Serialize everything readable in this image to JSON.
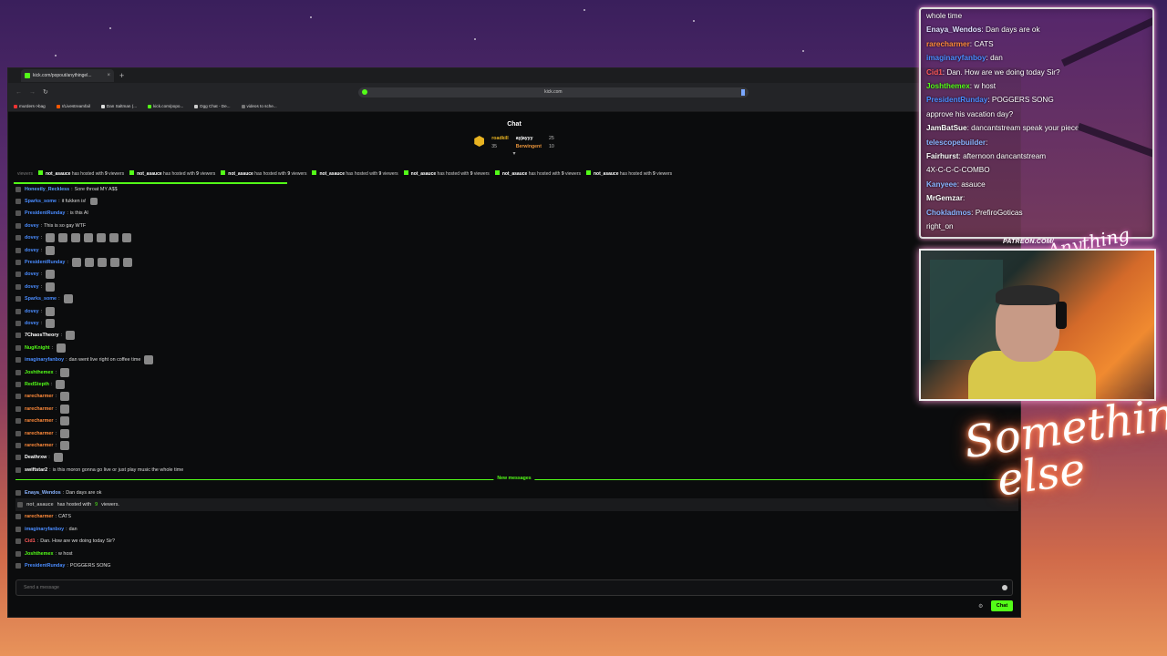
{
  "browser": {
    "tab_title": "kick.com/popout/anythingel...",
    "new_tab_symbol": "+",
    "tab_close_symbol": "×",
    "url": "kick.com",
    "bookmarks": [
      "murders->bag",
      "r/Livestreamfail",
      "Dan Saltman (...",
      "kick.com/popo...",
      "Dgg Chat - De...",
      "videos to sche..."
    ]
  },
  "chat": {
    "title": "Chat",
    "leaderboard": [
      {
        "name": "roadkill",
        "count": "35"
      },
      {
        "name": "ayjayyy",
        "count": "25"
      },
      {
        "name": "Berwingent",
        "count": "10"
      }
    ],
    "hosted_line": {
      "lead": "viewers",
      "user": "not_asauce",
      "text": "has hosted with",
      "count": "9",
      "suffix": "viewers",
      "repeat": 7
    },
    "messages": [
      {
        "user": "Honestly_Reckless",
        "color": "#5aa0ff",
        "text": "Sore throat MY A$$"
      },
      {
        "user": "Sparks_some",
        "color": "#4a8cff",
        "text": "it fukken is!",
        "emote": true
      },
      {
        "user": "PresidentRunday",
        "color": "#4a8cff",
        "text": "is this AI"
      },
      {
        "user": "dovey",
        "color": "#4a8cff",
        "text": "This is so gay WTF"
      },
      {
        "user": "dovey",
        "color": "#4a8cff",
        "text": "",
        "emotes": 7
      },
      {
        "user": "dovey",
        "color": "#4a8cff",
        "text": "",
        "emotes": 1
      },
      {
        "user": "PresidentRunday",
        "color": "#4a8cff",
        "text": "",
        "emotes": 5
      },
      {
        "user": "dovey",
        "color": "#4a8cff",
        "text": "",
        "emotes": 1
      },
      {
        "user": "dovey",
        "color": "#4a8cff",
        "text": "",
        "emotes": 1
      },
      {
        "user": "Sparks_some",
        "color": "#4a8cff",
        "text": "",
        "emotes": 1
      },
      {
        "user": "dovey",
        "color": "#4a8cff",
        "text": "",
        "emotes": 1
      },
      {
        "user": "dovey",
        "color": "#4a8cff",
        "text": "",
        "emotes": 1
      },
      {
        "user": "7ChaosTheory",
        "color": "#ffffff",
        "text": "",
        "emotes": 1
      },
      {
        "user": "NugKnight",
        "color": "#53fc18",
        "text": "",
        "emotes": 1
      },
      {
        "user": "imaginaryfanboy",
        "color": "#4a8cff",
        "text": "dan went live right on coffee time",
        "emotes": 1
      },
      {
        "user": "Joshthemex",
        "color": "#53fc18",
        "text": "",
        "emotes": 1
      },
      {
        "user": "RedStepth",
        "color": "#53fc18",
        "text": "",
        "emotes": 1
      },
      {
        "user": "rarecharmer",
        "color": "#ff8a3a",
        "text": "",
        "emotes": 1
      },
      {
        "user": "rarecharmer",
        "color": "#ff8a3a",
        "text": "",
        "emotes": 1
      },
      {
        "user": "rarecharmer",
        "color": "#ff8a3a",
        "text": "",
        "emotes": 1
      },
      {
        "user": "rarecharmer",
        "color": "#ff8a3a",
        "text": "",
        "emotes": 1
      },
      {
        "user": "rarecharmer",
        "color": "#ff8a3a",
        "text": "",
        "emotes": 1
      },
      {
        "user": "Deathrxw",
        "color": "#ffffff",
        "text": "",
        "emotes": 1
      },
      {
        "user": "swiftstar2",
        "color": "#ffffff",
        "text": "is this moron gonna go live or just play music the whole time"
      }
    ],
    "new_messages_label": "New messages",
    "recent": [
      {
        "user": "Enaya_Wendos",
        "color": "#8ab4ff",
        "text": "Dan days are ok"
      },
      {
        "user": "not_asauce",
        "color": "#aaaaaa",
        "text": "has hosted with",
        "count": "9",
        "suffix": "viewers.",
        "host": true
      },
      {
        "user": "rarecharmer",
        "color": "#ff8a3a",
        "text": "CATS"
      },
      {
        "user": "imaginaryfanboy",
        "color": "#4a8cff",
        "text": "dan"
      },
      {
        "user": "Cid1",
        "color": "#ff5a5a",
        "text": "Dan. How are we doing today Sir?"
      },
      {
        "user": "Joshthemex",
        "color": "#53fc18",
        "text": "w host"
      },
      {
        "user": "PresidentRunday",
        "color": "#4a8cff",
        "text": "POGGERS SONG"
      }
    ],
    "input_placeholder": "Send a message",
    "send_label": "Chat",
    "settings_symbol": "⚙"
  },
  "overlay_chat": [
    {
      "user": "",
      "color": "#ffffff",
      "text": "whole time"
    },
    {
      "user": "Enaya_Wendos",
      "color": "#e0e0ff",
      "text": "Dan days are ok"
    },
    {
      "user": "rarecharmer",
      "color": "#ff8a3a",
      "text": "CATS"
    },
    {
      "user": "imaginaryfanboy",
      "color": "#4a8cff",
      "text": "dan"
    },
    {
      "user": "Cid1",
      "color": "#ff5a5a",
      "text": "Dan. How are we doing today Sir?"
    },
    {
      "user": "Joshthemex",
      "color": "#53fc18",
      "text": "w host"
    },
    {
      "user": "PresidentRunday",
      "color": "#4a8cff",
      "text": "POGGERS SONG"
    },
    {
      "user": "",
      "color": "#ffffff",
      "text": "approve his vacation day?"
    },
    {
      "user": "JamBatSue",
      "color": "#ffffff",
      "text": "dancantstream speak your piece"
    },
    {
      "user": "telescopebuilder",
      "color": "#8ab4ff",
      "text": ""
    },
    {
      "user": "Fairhurst",
      "color": "#ffffff",
      "text": "afternoon dancantstream"
    },
    {
      "user": "",
      "color": "#ffffff",
      "text": "4X-C-C-C-COMBO"
    },
    {
      "user": "Kanyeee",
      "color": "#8ab4ff",
      "text": "asauce"
    },
    {
      "user": "MrGemzar",
      "color": "#ffffff",
      "text": ""
    },
    {
      "user": "Chokladmos",
      "color": "#8ab4ff",
      "text": "PrefiroGoticas"
    },
    {
      "user": "",
      "color": "#ffffff",
      "text": "right_on"
    }
  ],
  "branding": {
    "patreon": "PATREON.COM/",
    "signature": "Anything else",
    "neon_line1": "Something",
    "neon_line2": "else"
  }
}
